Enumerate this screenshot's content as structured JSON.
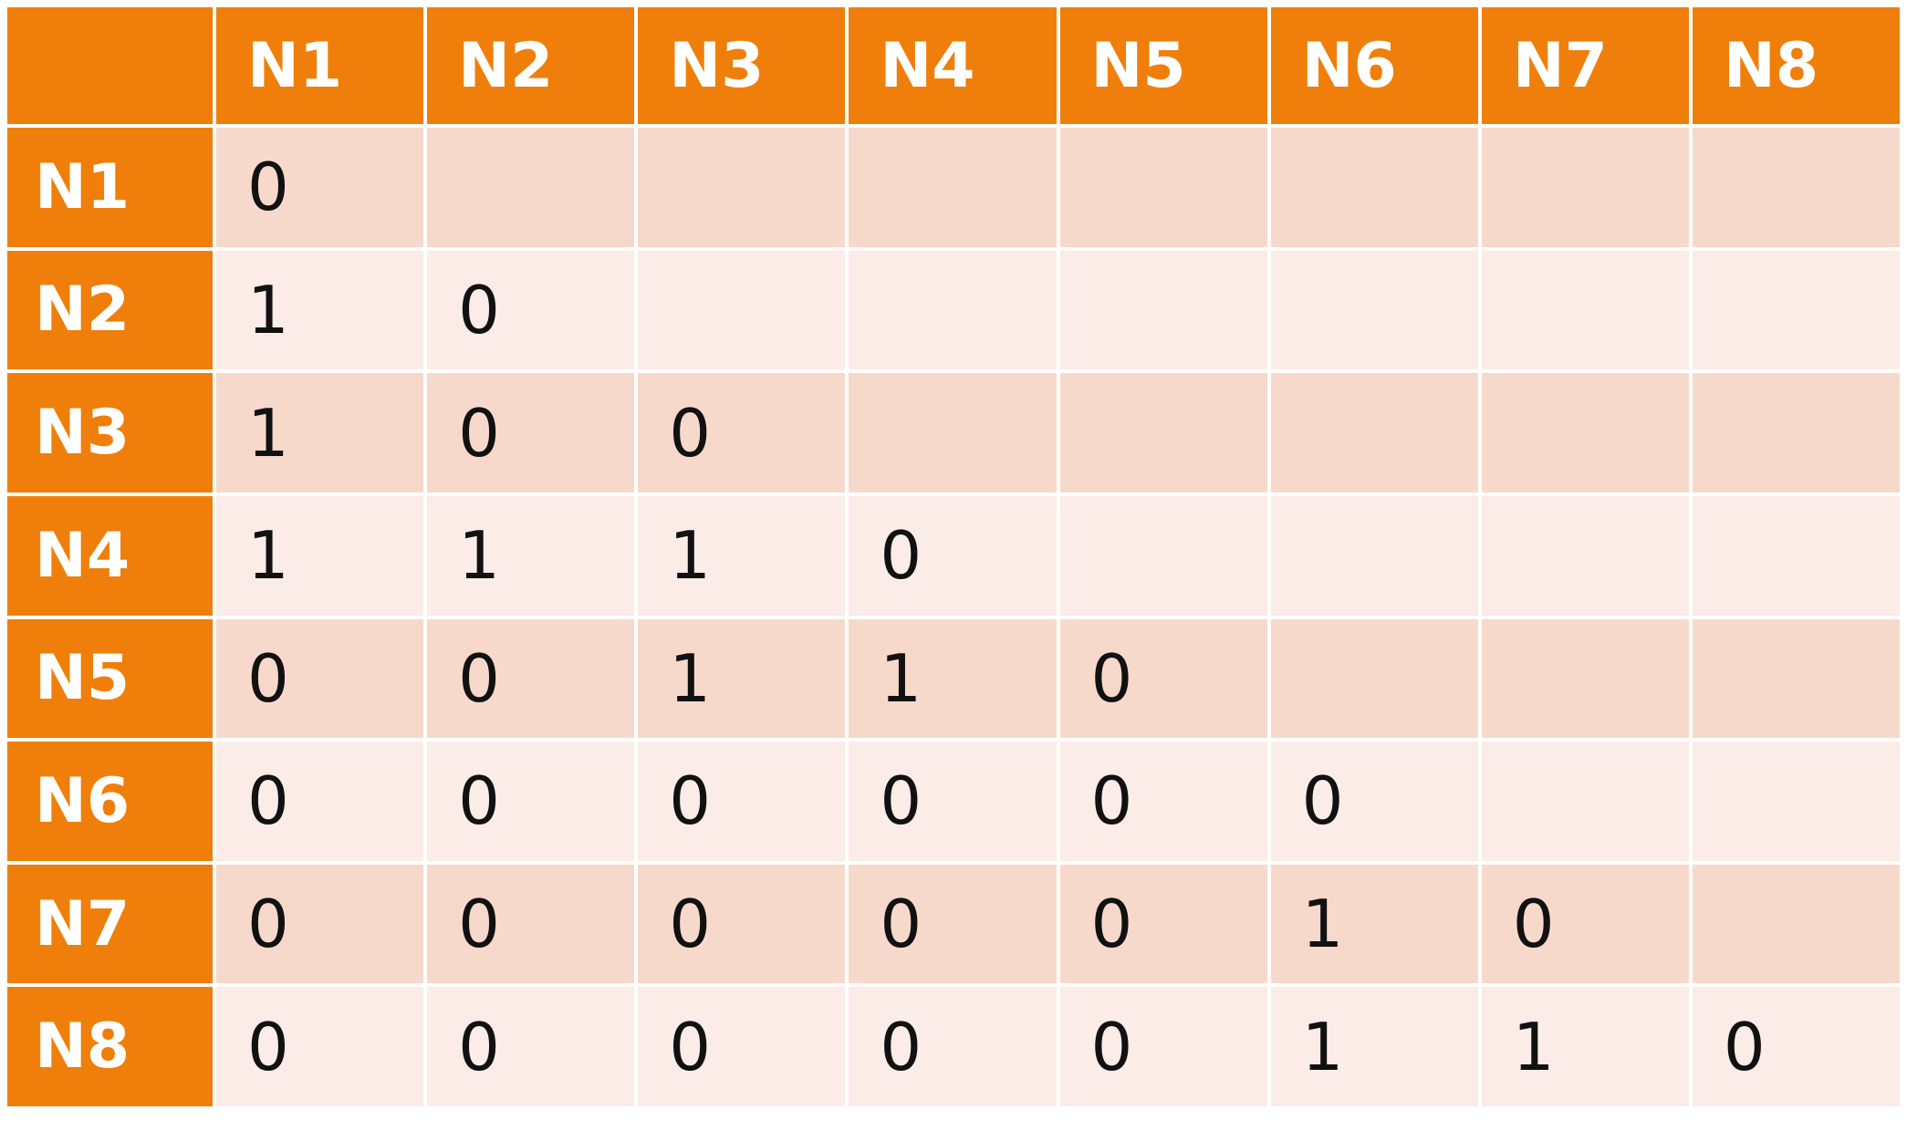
{
  "columns": [
    "N1",
    "N2",
    "N3",
    "N4",
    "N5",
    "N6",
    "N7",
    "N8"
  ],
  "rows": [
    {
      "label": "N1",
      "values": [
        "0",
        "",
        "",
        "",
        "",
        "",
        "",
        ""
      ]
    },
    {
      "label": "N2",
      "values": [
        "1",
        "0",
        "",
        "",
        "",
        "",
        "",
        ""
      ]
    },
    {
      "label": "N3",
      "values": [
        "1",
        "0",
        "0",
        "",
        "",
        "",
        "",
        ""
      ]
    },
    {
      "label": "N4",
      "values": [
        "1",
        "1",
        "1",
        "0",
        "",
        "",
        "",
        ""
      ]
    },
    {
      "label": "N5",
      "values": [
        "0",
        "0",
        "1",
        "1",
        "0",
        "",
        "",
        ""
      ]
    },
    {
      "label": "N6",
      "values": [
        "0",
        "0",
        "0",
        "0",
        "0",
        "0",
        "",
        ""
      ]
    },
    {
      "label": "N7",
      "values": [
        "0",
        "0",
        "0",
        "0",
        "0",
        "1",
        "0",
        ""
      ]
    },
    {
      "label": "N8",
      "values": [
        "0",
        "0",
        "0",
        "0",
        "0",
        "1",
        "1",
        "0"
      ]
    }
  ],
  "colors": {
    "header": "#EF7F0A",
    "band_dark": "#F7D9CC",
    "band_light": "#FBECE7",
    "header_text": "#FFFFFF",
    "cell_text": "#111111"
  }
}
